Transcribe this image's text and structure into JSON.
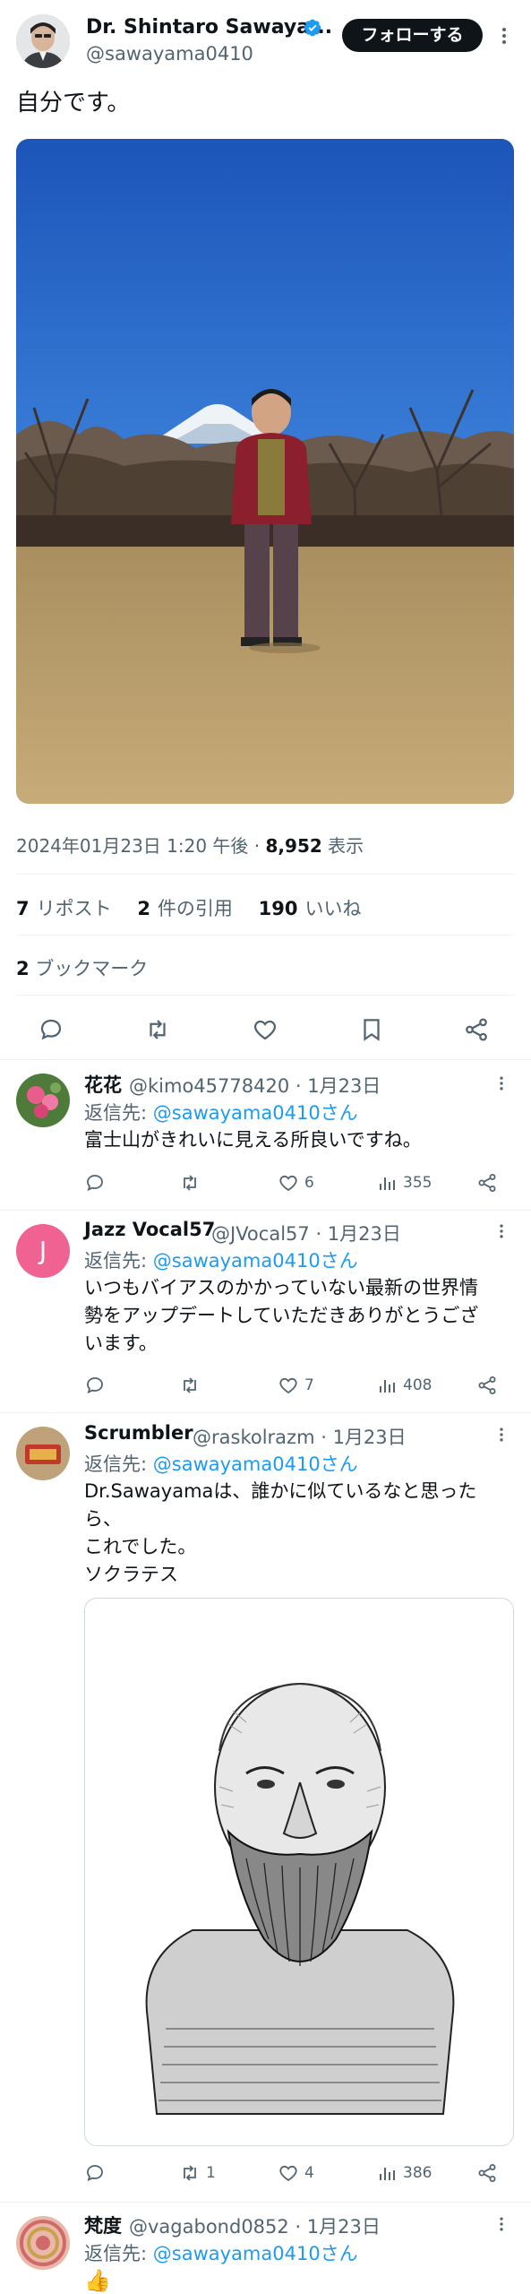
{
  "main_tweet": {
    "author_name": "Dr. Shintaro Sawaya...",
    "handle": "@sawayama0410",
    "follow_label": "フォローする",
    "text": "自分です。",
    "timestamp": "2024年01月23日 1:20 午後",
    "separator": "·",
    "views_count": "8,952",
    "views_label": "表示",
    "reposts_count": "7",
    "reposts_label": "リポスト",
    "quotes_count": "2",
    "quotes_label": "件の引用",
    "likes_count": "190",
    "likes_label": "いいね",
    "bookmarks_count": "2",
    "bookmarks_label": "ブックマーク"
  },
  "replies": [
    {
      "name": "花花",
      "handle": "@kimo45778420",
      "date": "· 1月23日",
      "reply_prefix": "返信先: ",
      "reply_to": "@sawayama0410さん",
      "text": "富士山がきれいに見える所良いですね。",
      "reposts": "",
      "likes": "6",
      "views": "355"
    },
    {
      "name": "Jazz Vocal57",
      "avatar_letter": "J",
      "handle": "@JVocal57",
      "date": "· 1月23日",
      "reply_prefix": "返信先: ",
      "reply_to": "@sawayama0410さん",
      "text_lines": [
        "いつもバイアスのかかっていない最新の世界情",
        "勢をアップデートしていただきありがとうござ",
        "います。"
      ],
      "reposts": "",
      "likes": "7",
      "views": "408"
    },
    {
      "name": "Scrumbler",
      "handle": "@raskolrazm",
      "date": "· 1月23日",
      "reply_prefix": "返信先: ",
      "reply_to": "@sawayama0410さん",
      "text_lines": [
        "Dr.Sawayamaは、誰かに似ているなと思った",
        "ら、",
        "これでした。",
        "ソクラテス"
      ],
      "reposts": "1",
      "likes": "4",
      "views": "386"
    },
    {
      "name": "梵度",
      "handle": "@vagabond0852",
      "date": "· 1月23日",
      "reply_prefix": "返信先: ",
      "reply_to": "@sawayama0410さん",
      "text": "👍"
    }
  ],
  "colors": {
    "accent": "#1d9bf0",
    "text": "#0f1419",
    "muted": "#536471",
    "divider": "#eff3f4",
    "jazz_avatar": "#f06292"
  }
}
